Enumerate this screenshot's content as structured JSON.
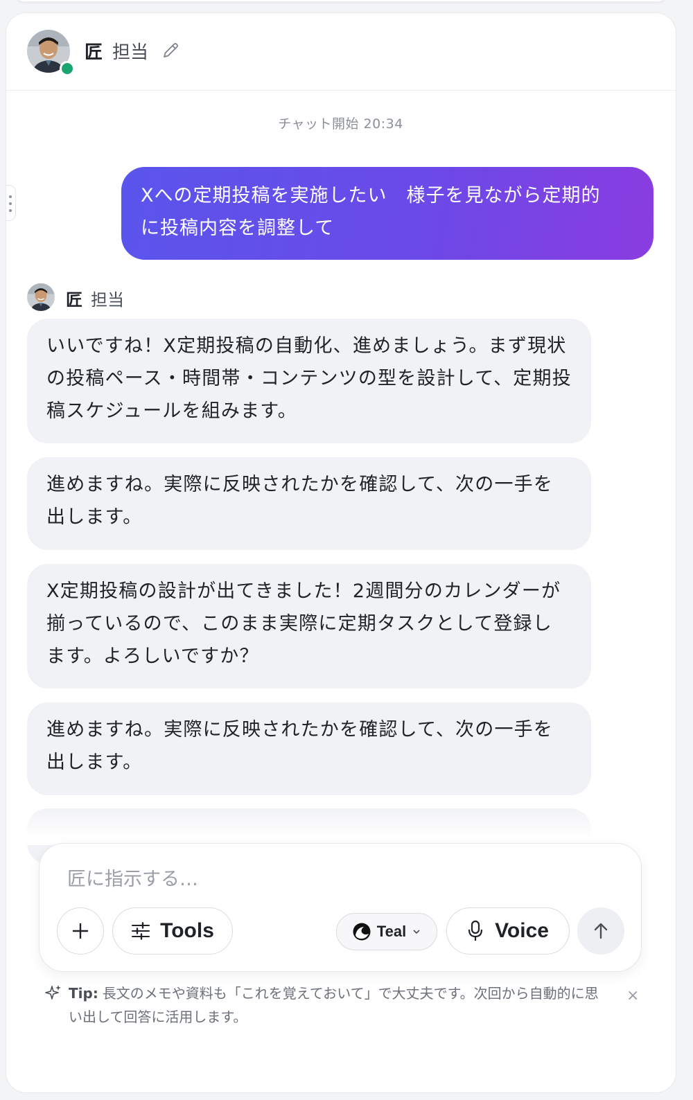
{
  "header": {
    "name_primary": "匠",
    "name_secondary": "担当",
    "online_color": "#1aa46f",
    "edit_icon": "pencil-icon"
  },
  "chat": {
    "timestamp": "チャット開始 20:34",
    "user_message": "Xへの定期投稿を実施したい　様子を見ながら定期的\nに投稿内容を調整して",
    "bot_name_primary": "匠",
    "bot_name_secondary": "担当",
    "bot_messages": [
      "いいですね！X定期投稿の自動化、進めましょう。まず現状の投稿ペース・時間帯・コンテンツの型を設計して、定期投稿スケジュールを組みます。",
      "進めますね。実際に反映されたかを確認して、次の一手を出します。",
      "X定期投稿の設計が出てきました！2週間分のカレンダーが揃っているので、このまま実際に定期タスクとして登録します。よろしいですか？",
      "進めますね。実際に反映されたかを確認して、次の一手を出します。"
    ]
  },
  "composer": {
    "placeholder": "匠に指示する…",
    "tools_label": "Tools",
    "model_label": "Teal",
    "voice_label": "Voice"
  },
  "tip": {
    "label": "Tip:",
    "text": "長文のメモや資料も「これを覚えておいて」で大丈夫です。次回から自動的に思い出して回答に活用します。",
    "close": "×"
  },
  "colors": {
    "user_bubble_start": "#5a55ec",
    "user_bubble_end": "#8a3ce0",
    "bot_bubble": "#f1f2f5"
  }
}
